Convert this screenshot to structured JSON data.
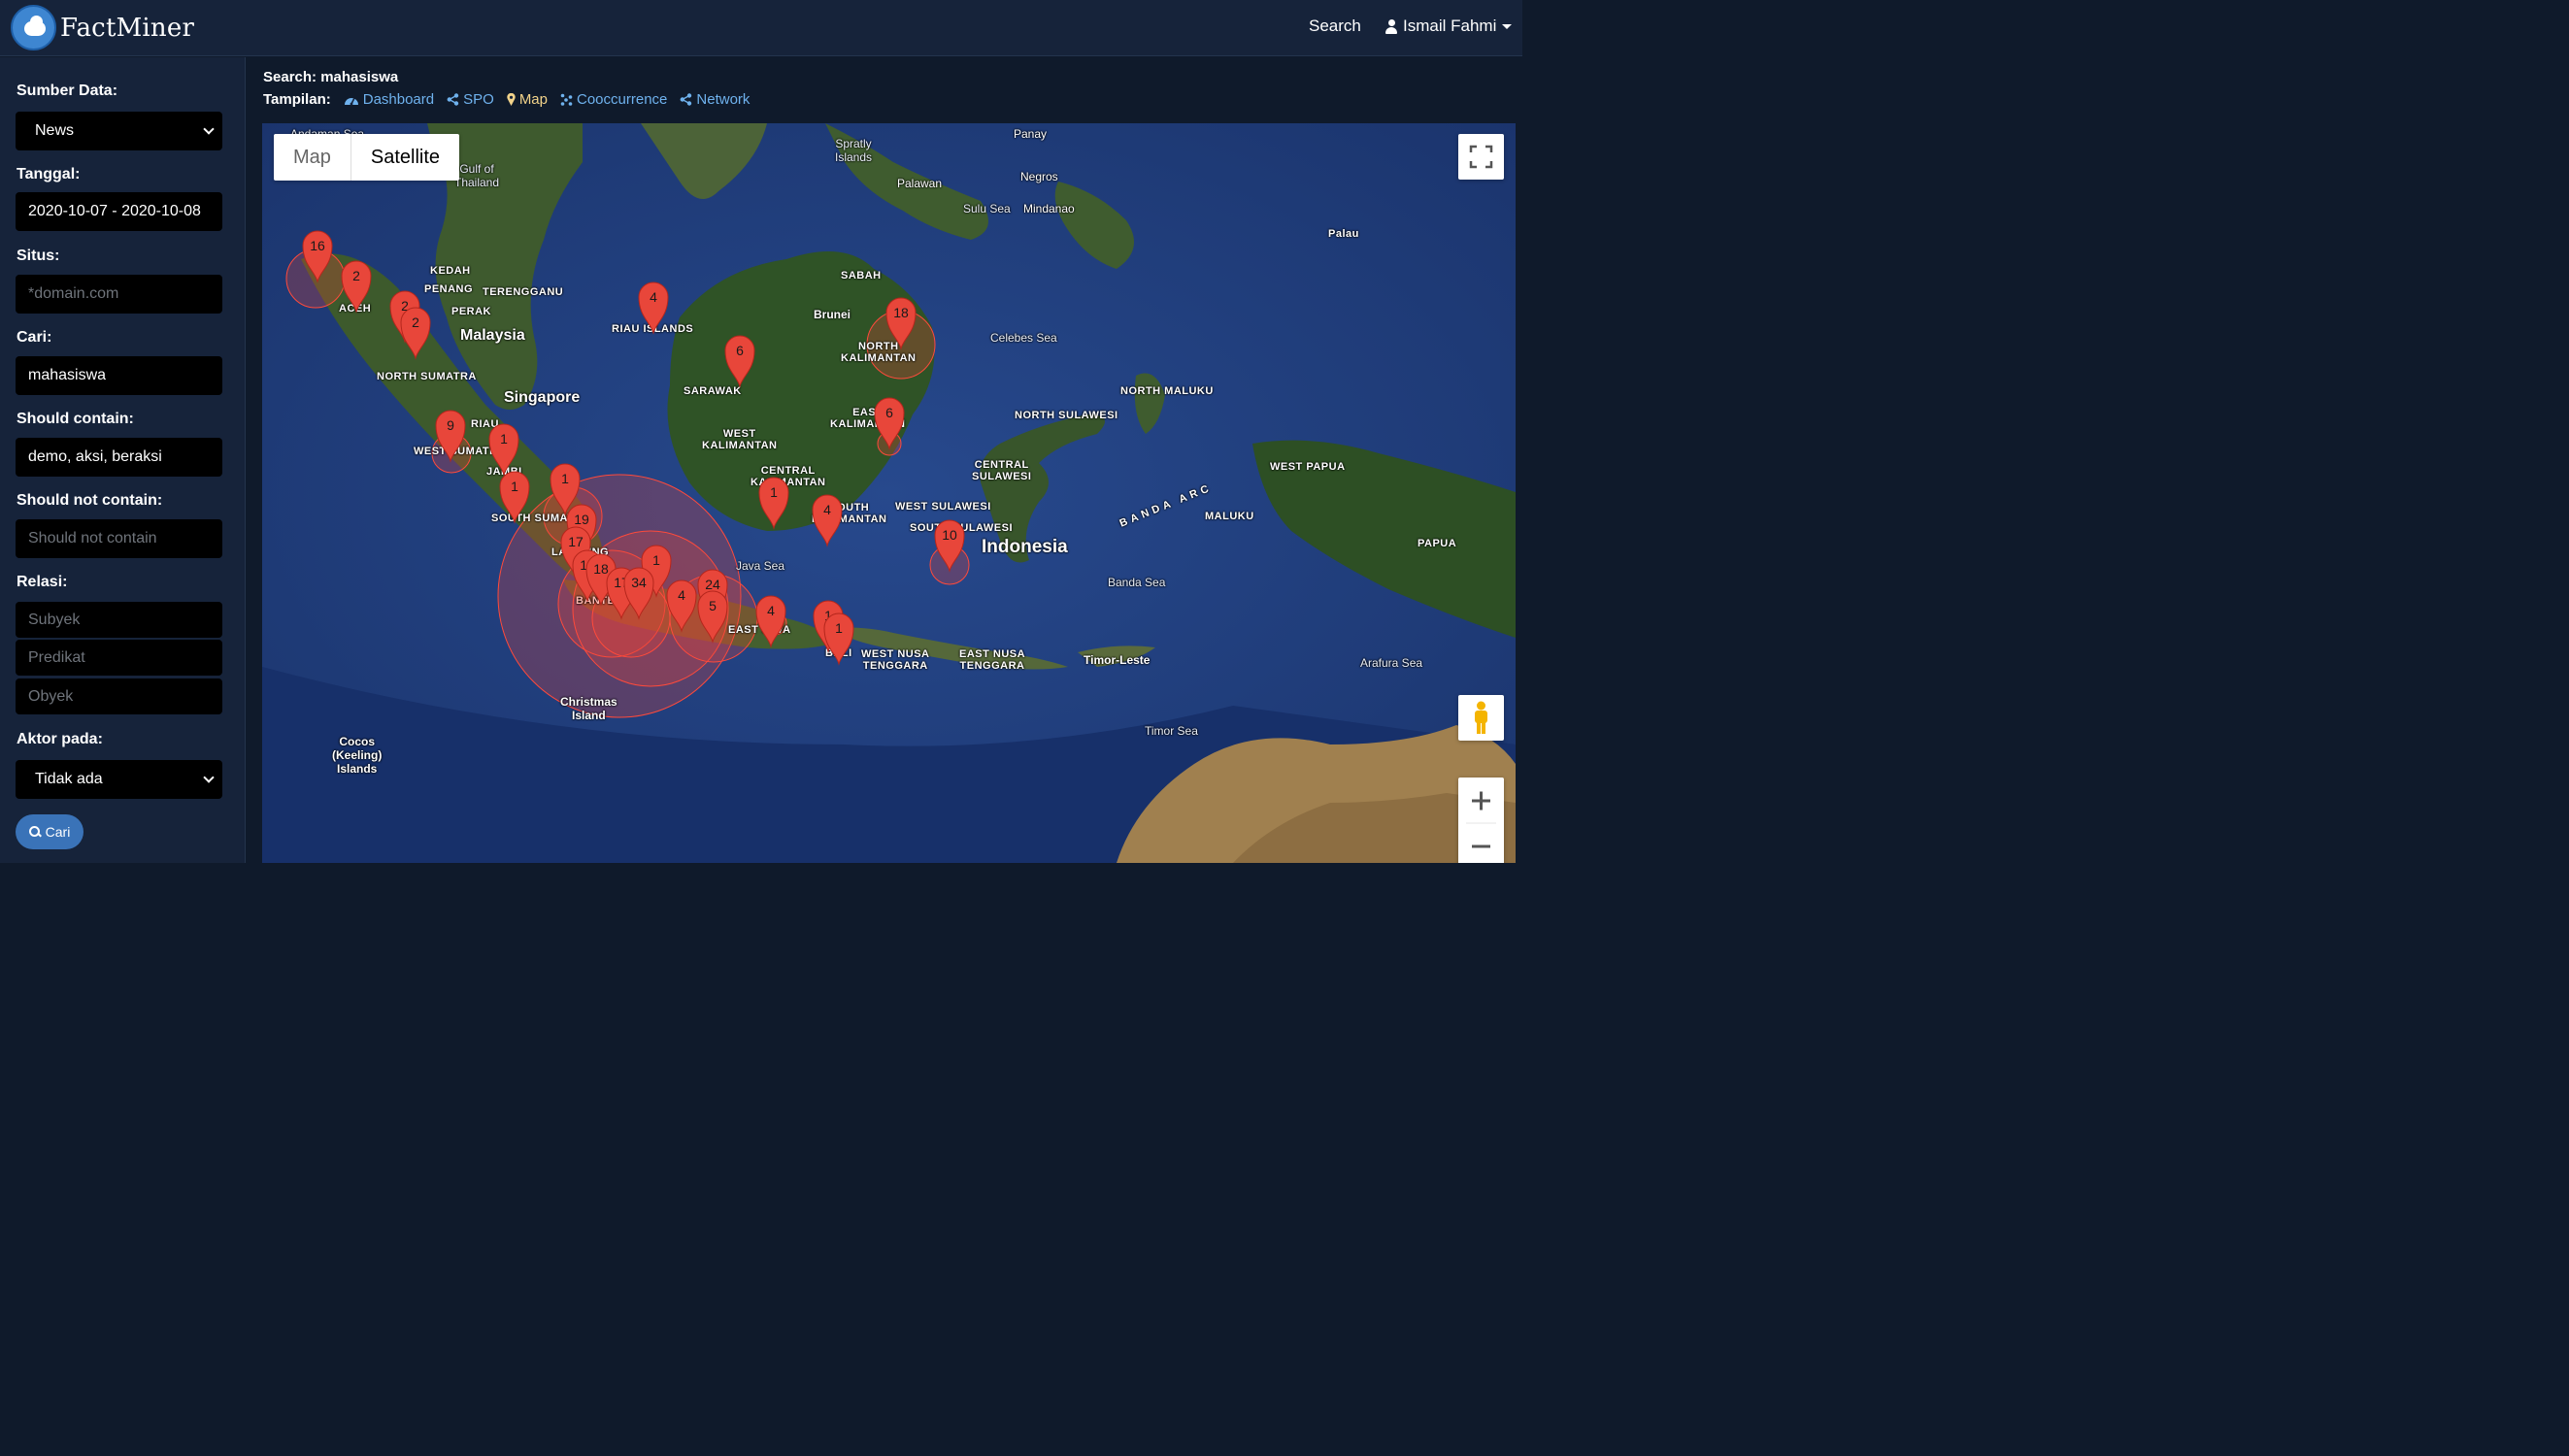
{
  "brand": {
    "name": "FactMiner"
  },
  "nav": {
    "search": "Search",
    "user": "Ismail Fahmi"
  },
  "sidebar": {
    "sumber_label": "Sumber Data:",
    "sumber_value": "News",
    "tanggal_label": "Tanggal:",
    "tanggal_value": "2020-10-07 - 2020-10-08",
    "situs_label": "Situs:",
    "situs_placeholder": "*domain.com",
    "cari_label": "Cari:",
    "cari_value": "mahasiswa",
    "should_label": "Should contain:",
    "should_value": "demo, aksi, beraksi",
    "shouldnot_label": "Should not contain:",
    "shouldnot_placeholder": "Should not contain",
    "relasi_label": "Relasi:",
    "subyek_placeholder": "Subyek",
    "predikat_placeholder": "Predikat",
    "obyek_placeholder": "Obyek",
    "aktor_label": "Aktor pada:",
    "aktor_value": "Tidak ada",
    "button": "Cari"
  },
  "header": {
    "search_line": "Search: mahasiswa",
    "tampilan": "Tampilan:",
    "views": [
      "Dashboard",
      "SPO",
      "Map",
      "Cooccurrence",
      "Network"
    ],
    "active_view": "Map"
  },
  "map": {
    "type_map": "Map",
    "type_satellite": "Satellite",
    "active_type": "Satellite",
    "labels": {
      "andaman": "Andaman Sea",
      "gulf": "Gulf of\nThailand",
      "spratly": "Spratly\nIslands",
      "panay": "Panay",
      "palawan": "Palawan",
      "negros": "Negros",
      "sulu": "Sulu Sea",
      "mindanao": "Mindanao",
      "palau": "Palau",
      "kedah": "KEDAH",
      "penang": "PENANG",
      "terengganu": "TERENGGANU",
      "perak": "PERAK",
      "malaysia": "Malaysia",
      "aceh": "ACEH",
      "sabah": "SABAH",
      "brunei": "Brunei",
      "riau_islands": "RIAU ISLANDS",
      "north_kalimantan": "NORTH\nKALIMANTAN",
      "celebes": "Celebes Sea",
      "north_sumatra": "NORTH SUMATRA",
      "singapore": "Singapore",
      "riau": "RIAU",
      "sarawak": "SARAWAK",
      "west_kalimantan": "WEST\nKALIMANTAN",
      "east_kalimantan": "EAST\nKALIMANTAN",
      "north_maluku": "NORTH MALUKU",
      "north_sulawesi": "NORTH SULAWESI",
      "west_sumatra": "WEST SUMATRA",
      "jambi": "JAMBI",
      "central_kalimantan": "CENTRAL\nKALIMANTAN",
      "central_sulawesi": "CENTRAL\nSULAWESI",
      "west_papua": "WEST PAPUA",
      "banda_arc": "BANDA ARC",
      "south_kalimantan": "SOUTH\nKALIMANTAN",
      "west_sulawesi": "WEST SULAWESI",
      "maluku": "MALUKU",
      "south_sumatra": "SOUTH SUMATRA",
      "south_sulawesi": "SOUTH SULAWESI",
      "indonesia": "Indonesia",
      "papua": "PAPUA",
      "lampung": "LAMPUNG",
      "java_sea": "Java Sea",
      "banten": "BANTEN",
      "east_java": "EAST JAVA",
      "banda_sea": "Banda Sea",
      "bali": "BALI",
      "west_nusa": "WEST NUSA\nTENGGARA",
      "east_nusa": "EAST NUSA\nTENGGARA",
      "timor_leste": "Timor-Leste",
      "arafura": "Arafura Sea",
      "christmas": "Christmas\nIsland",
      "timor_sea": "Timor Sea",
      "cocos": "Cocos\n(Keeling)\nIslands"
    },
    "markers": [
      "16",
      "2",
      "2",
      "2",
      "4",
      "18",
      "6",
      "6",
      "9",
      "1",
      "1",
      "1",
      "19",
      "17",
      "13",
      "1",
      "1",
      "4",
      "10",
      "18",
      "17",
      "34",
      "4",
      "24",
      "5",
      "4",
      "1",
      "1"
    ]
  },
  "colors": {
    "background": "#0f1a2b",
    "panel": "#16233a",
    "link": "#6fb2ee",
    "active_link": "#f2d38a",
    "marker": "#e8463a",
    "button": "#3a73b8"
  }
}
